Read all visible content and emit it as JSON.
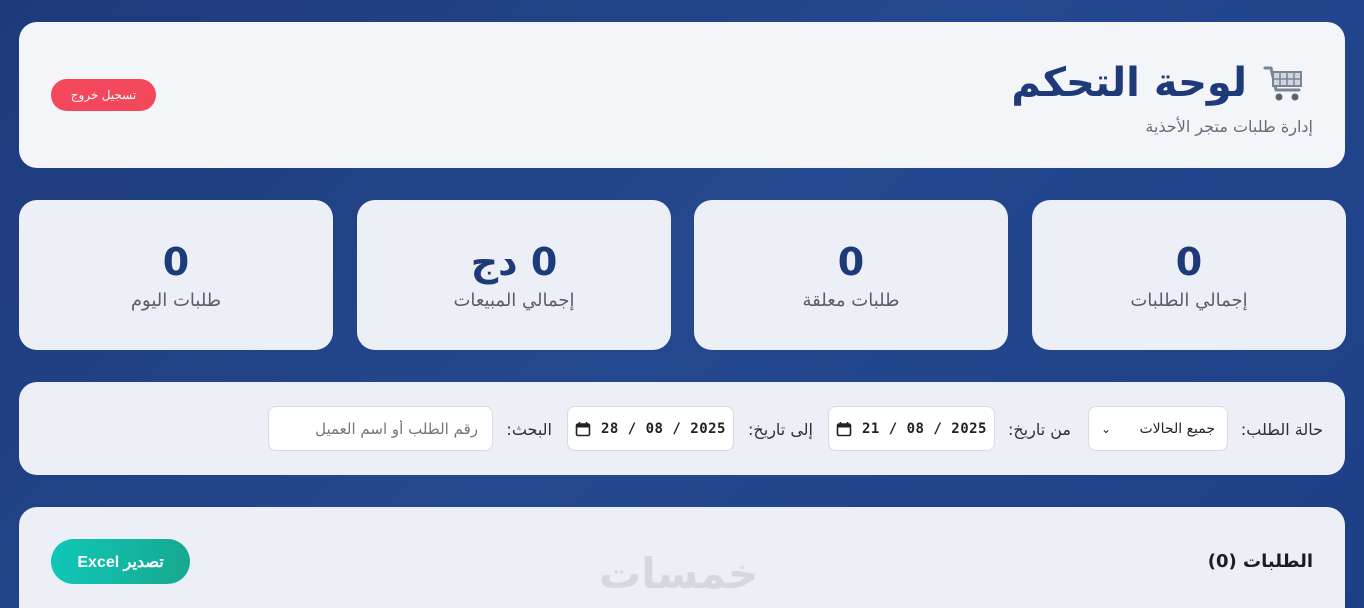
{
  "header": {
    "title": "لوحة التحكم",
    "subtitle": "إدارة طلبات متجر الأحذية",
    "logout_label": "تسجيل خروج",
    "icon": "shopping-cart-icon"
  },
  "stats": [
    {
      "value": "0",
      "label": "إجمالي الطلبات"
    },
    {
      "value": "0",
      "label": "طلبات معلقة"
    },
    {
      "value": "0 دج",
      "label": "إجمالي المبيعات"
    },
    {
      "value": "0",
      "label": "طلبات اليوم"
    }
  ],
  "filters": {
    "status_label": "حالة الطلب:",
    "status_value": "جميع الحالات",
    "from_label": "من تاريخ:",
    "from_value": "21 / 08 / 2025",
    "to_label": "إلى تاريخ:",
    "to_value": "28 / 08 / 2025",
    "search_label": "البحث:",
    "search_placeholder": "رقم الطلب أو اسم العميل"
  },
  "orders": {
    "title": "الطلبات (0)",
    "export_label": "تصدير Excel",
    "watermark": "خمسات"
  },
  "colors": {
    "background": "#1e3a7a",
    "accent": "#1e3a78",
    "logout": "#f3475b",
    "export": "#10c7b8"
  }
}
